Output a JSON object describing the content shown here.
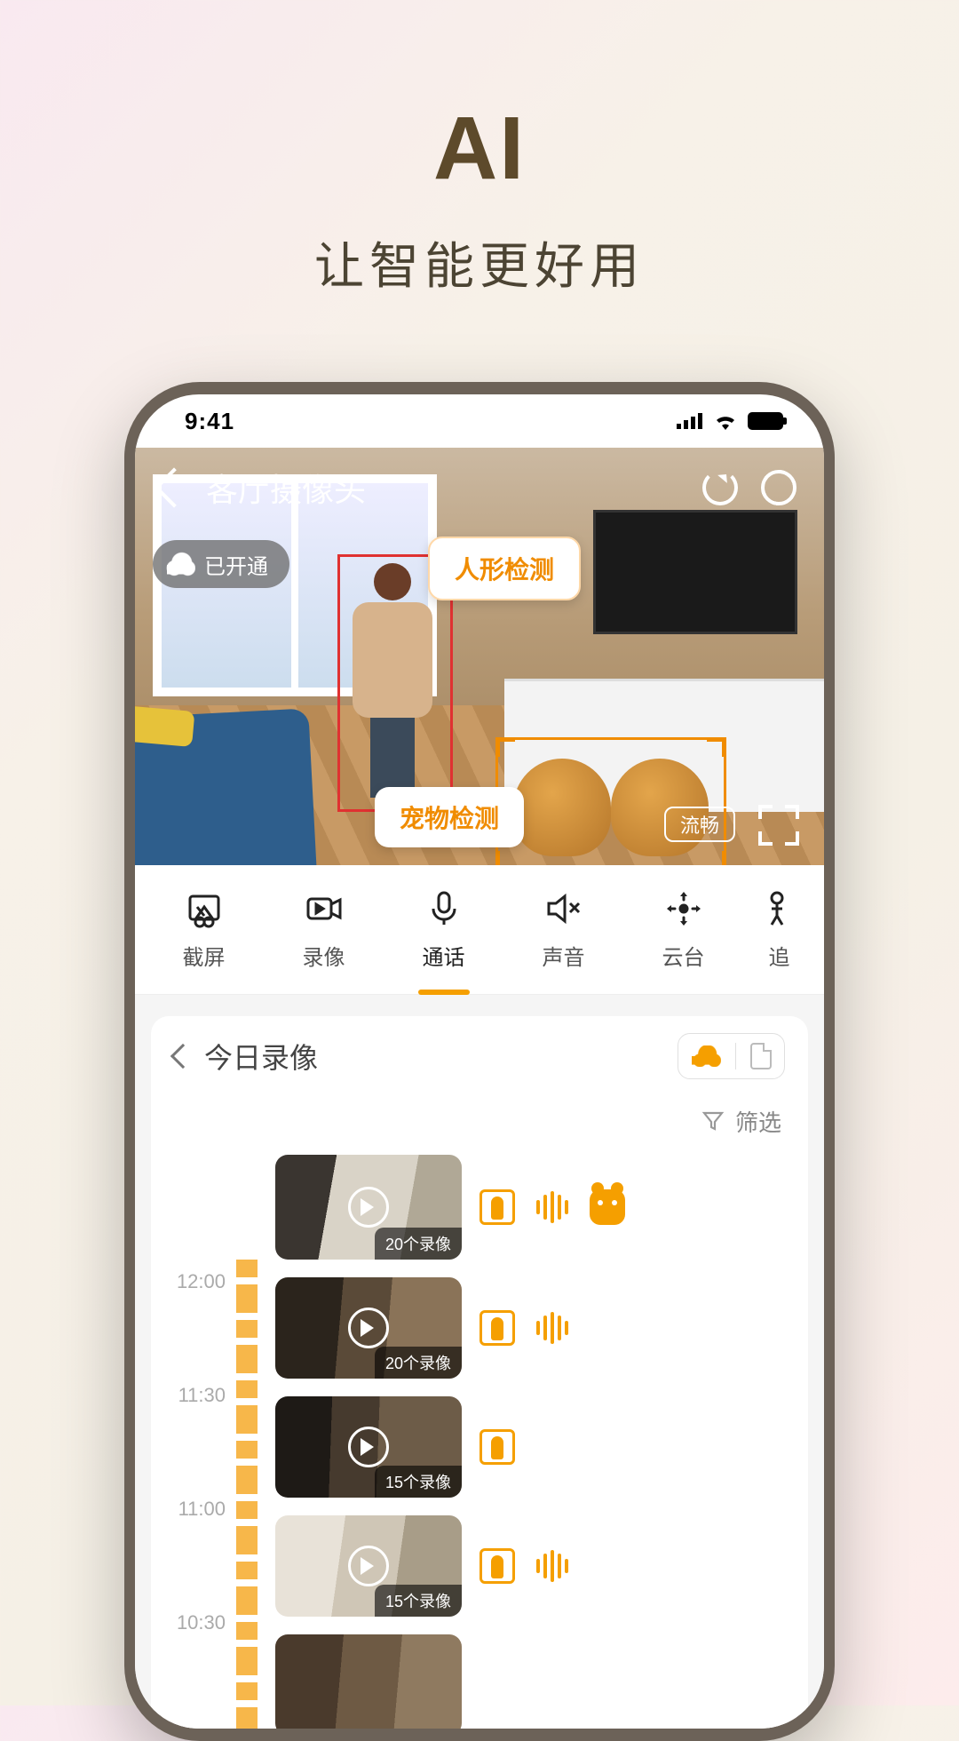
{
  "hero": {
    "title": "AI",
    "subtitle": "让智能更好用"
  },
  "status": {
    "time": "9:41"
  },
  "camera": {
    "title": "客厅摄像头",
    "cloud_status": "已开通",
    "detect_human": "人形检测",
    "detect_pet": "宠物检测",
    "quality": "流畅"
  },
  "controls": {
    "screenshot": "截屏",
    "record": "录像",
    "talk": "通话",
    "sound": "声音",
    "ptz": "云台",
    "track": "追"
  },
  "recordings": {
    "title": "今日录像",
    "filter": "筛选",
    "timeline": [
      "12:00",
      "11:30",
      "11:00",
      "10:30"
    ],
    "clips": [
      {
        "count": "20个录像",
        "tags": [
          "human",
          "wave",
          "pet"
        ]
      },
      {
        "count": "20个录像",
        "tags": [
          "human",
          "wave"
        ]
      },
      {
        "count": "15个录像",
        "tags": [
          "human"
        ]
      },
      {
        "count": "15个录像",
        "tags": [
          "human",
          "wave"
        ]
      },
      {
        "count": "",
        "tags": []
      }
    ]
  }
}
